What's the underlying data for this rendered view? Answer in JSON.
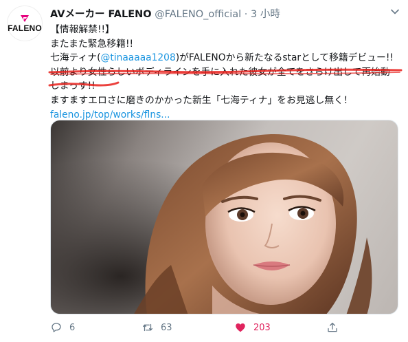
{
  "tweet": {
    "account": {
      "avatar_logo_text": "FALENO",
      "display_name": "AVメーカー FALENO",
      "handle": "@FALENO_official",
      "separator": "·",
      "timestamp": "3 小時"
    },
    "lines": {
      "l1": "【情報解禁!!】",
      "l2": "またまた緊急移籍!!",
      "l3_pre": "七海ティナ(",
      "l3_mention": "@tinaaaaa1208",
      "l3_post": ")がFALENOから新たなるstarとして移籍デビュー!!",
      "l4": "以前より女性らしいボディラインを手に入れた彼女が全てをさらけ出して再始動",
      "l5": "しまっす!!",
      "l6": "ますますエロさに磨きのかかった新生「七海ティナ」をお見逃し無く！",
      "l7_link": "faleno.jp/top/works/flns..."
    },
    "actions": {
      "reply_count": "6",
      "retweet_count": "63",
      "like_count": "203"
    },
    "colors": {
      "link": "#1b95e0",
      "secondary_text": "#657786",
      "like": "#e0245e",
      "annotation_red": "#e8201b",
      "brand_pink": "#e6007e"
    }
  }
}
